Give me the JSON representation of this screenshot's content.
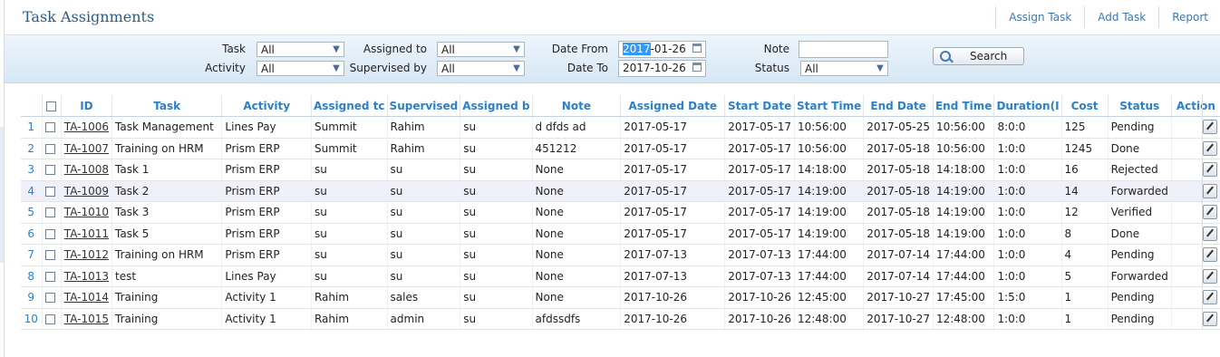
{
  "header": {
    "title": "Task Assignments",
    "links": [
      "Assign Task",
      "Add Task",
      "Report"
    ]
  },
  "filters": {
    "task_label": "Task",
    "task_value": "All",
    "activity_label": "Activity",
    "activity_value": "All",
    "assigned_to_label": "Assigned to",
    "assigned_to_value": "All",
    "supervised_by_label": "Supervised by",
    "supervised_by_value": "All",
    "date_from_label": "Date From",
    "date_from_sel": "2017",
    "date_from_rest": "-01-26",
    "date_to_label": "Date To",
    "date_to_value": "2017-10-26",
    "note_label": "Note",
    "note_value": "",
    "status_label": "Status",
    "status_value": "All",
    "search_label": "Search"
  },
  "grid": {
    "columns": [
      "",
      "ID",
      "Task",
      "Activity",
      "Assigned tc",
      "Supervised",
      "Assigned b",
      "Note",
      "Assigned Date",
      "Start Date",
      "Start Time",
      "End Date",
      "End Time",
      "Duration(I",
      "Cost",
      "Status",
      "Action"
    ],
    "rows": [
      [
        "1",
        "TA-1006",
        "Task Management",
        "Lines Pay",
        "Summit",
        "Rahim",
        "su",
        "d dfds ad",
        "2017-05-17",
        "2017-05-17",
        "10:56:00",
        "2017-05-25",
        "10:56:00",
        "8:0:0",
        "125",
        "Pending"
      ],
      [
        "2",
        "TA-1007",
        "Training on HRM",
        "Prism ERP",
        "Summit",
        "Rahim",
        "su",
        "451212",
        "2017-05-17",
        "2017-05-17",
        "10:56:00",
        "2017-05-18",
        "10:56:00",
        "1:0:0",
        "1245",
        "Done"
      ],
      [
        "3",
        "TA-1008",
        "Task 1",
        "Prism ERP",
        "su",
        "su",
        "su",
        "None",
        "2017-05-17",
        "2017-05-17",
        "14:18:00",
        "2017-05-18",
        "14:18:00",
        "1:0:0",
        "16",
        "Rejected"
      ],
      [
        "4",
        "TA-1009",
        "Task 2",
        "Prism ERP",
        "su",
        "su",
        "su",
        "None",
        "2017-05-17",
        "2017-05-17",
        "14:19:00",
        "2017-05-18",
        "14:19:00",
        "1:0:0",
        "14",
        "Forwarded"
      ],
      [
        "5",
        "TA-1010",
        "Task 3",
        "Prism ERP",
        "su",
        "su",
        "su",
        "None",
        "2017-05-17",
        "2017-05-17",
        "14:19:00",
        "2017-05-18",
        "14:19:00",
        "1:0:0",
        "12",
        "Verified"
      ],
      [
        "6",
        "TA-1011",
        "Task 5",
        "Prism ERP",
        "su",
        "su",
        "su",
        "None",
        "2017-05-17",
        "2017-05-17",
        "14:19:00",
        "2017-05-18",
        "14:19:00",
        "1:0:0",
        "8",
        "Done"
      ],
      [
        "7",
        "TA-1012",
        "Training on HRM",
        "Prism ERP",
        "su",
        "su",
        "su",
        "None",
        "2017-07-13",
        "2017-07-13",
        "17:44:00",
        "2017-07-14",
        "17:44:00",
        "1:0:0",
        "4",
        "Pending"
      ],
      [
        "8",
        "TA-1013",
        "test",
        "Lines Pay",
        "su",
        "su",
        "su",
        "None",
        "2017-07-13",
        "2017-07-13",
        "17:44:00",
        "2017-07-14",
        "17:44:00",
        "1:0:0",
        "5",
        "Forwarded"
      ],
      [
        "9",
        "TA-1014",
        "Training",
        "Activity 1",
        "Rahim",
        "sales",
        "su",
        "None",
        "2017-10-26",
        "2017-10-26",
        "12:45:00",
        "2017-10-27",
        "17:45:00",
        "1:5:0",
        "1",
        "Pending"
      ],
      [
        "10",
        "TA-1015",
        "Training",
        "Activity 1",
        "Rahim",
        "admin",
        "su",
        "afdssdfs",
        "2017-10-26",
        "2017-10-26",
        "12:48:00",
        "2017-10-27",
        "12:48:00",
        "1:0:0",
        "1",
        "Pending"
      ]
    ]
  }
}
